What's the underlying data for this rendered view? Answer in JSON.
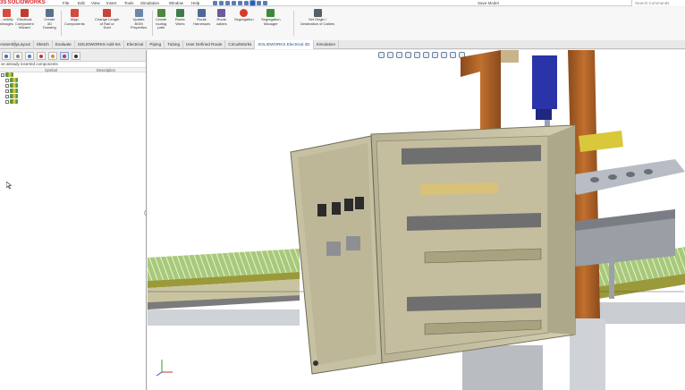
{
  "app": {
    "logo_prefix": "3S",
    "logo_text": "SOLIDWORKS",
    "document_title": "Save Model",
    "search_placeholder": "Search Commands"
  },
  "menu": [
    "File",
    "Edit",
    "View",
    "Insert",
    "Tools",
    "Simulation",
    "Window",
    "Help"
  ],
  "commands": [
    {
      "label": "...ectrify\nnlinages"
    },
    {
      "label": "Electrical\nComponent\nWizard"
    },
    {
      "label": "Create\n3D\nDrawing"
    },
    {
      "label": "Align\nComponents"
    },
    {
      "label": "Change Length\nof Rail or\nDuct"
    },
    {
      "label": "Update\nBOM\nProperties"
    },
    {
      "label": "Create\nrouting\npath"
    },
    {
      "label": "Route\nWires"
    },
    {
      "label": "Route\nHarnesses"
    },
    {
      "label": "Route\ncables"
    },
    {
      "label": "Segregation"
    },
    {
      "label": "Segregation\nManager"
    },
    {
      "label": "Set Origin /\nDestination of Cables"
    }
  ],
  "tabs": [
    "Assembly",
    "Layout",
    "Sketch",
    "Evaluate",
    "SOLIDWORKS Add-Ins",
    "Electrical",
    "Piping",
    "Tubing",
    "User Defined Route",
    "CircuitWorks",
    "SOLIDWORKS Electrical 3D",
    "Simulation"
  ],
  "active_tab": "SOLIDWORKS Electrical 3D",
  "left_panel": {
    "header": "ve already inserted components",
    "col_symbol": "Symbol",
    "col_description": "Description",
    "tree_count": 6
  },
  "colors": {
    "accent": "#1b4f9c",
    "logo_red": "#d4202a",
    "cabinet": "#c9c3a6",
    "conveyor_green": "#8fb85a",
    "wood": "#b5652a"
  },
  "icons": [
    "home-icon",
    "new-icon",
    "open-icon",
    "save-icon",
    "print-icon",
    "undo-icon",
    "select-icon",
    "rebuild-icon",
    "options-icon"
  ]
}
